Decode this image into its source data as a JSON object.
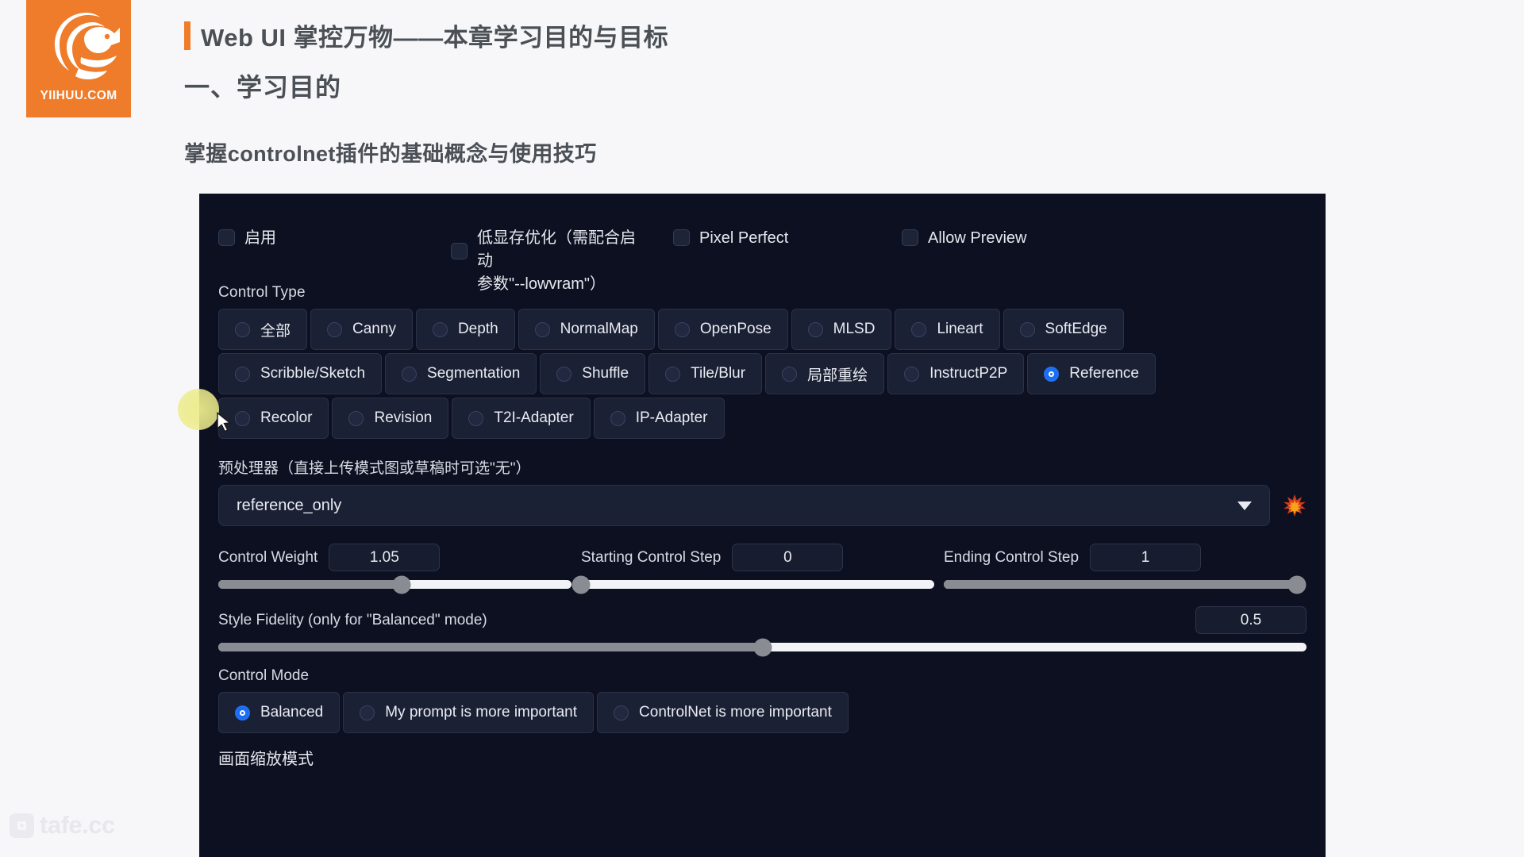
{
  "header": {
    "logo_text": "YIIHUU.COM",
    "logo_icon": "fox-logo-icon",
    "accent_color": "#ef7c2a",
    "title": "Web UI 掌控万物——本章学习目的与目标",
    "section": "一、学习目的",
    "body": "掌握controlnet插件的基础概念与使用技巧"
  },
  "watermark": {
    "text": "tafe.cc",
    "icon": "play-badge-icon"
  },
  "panel": {
    "background_color": "#0d1020",
    "checkboxes": [
      {
        "label": "启用",
        "checked": false
      },
      {
        "label": "低显存优化（需配合启动\n参数\"--lowvram\"）",
        "checked": false
      },
      {
        "label": "Pixel Perfect",
        "checked": false
      },
      {
        "label": "Allow Preview",
        "checked": false
      }
    ],
    "control_type": {
      "label": "Control Type",
      "selected": "Reference",
      "rows": [
        [
          {
            "label": "全部",
            "selected": false
          },
          {
            "label": "Canny",
            "selected": false
          },
          {
            "label": "Depth",
            "selected": false
          },
          {
            "label": "NormalMap",
            "selected": false
          },
          {
            "label": "OpenPose",
            "selected": false
          },
          {
            "label": "MLSD",
            "selected": false
          },
          {
            "label": "Lineart",
            "selected": false
          },
          {
            "label": "SoftEdge",
            "selected": false
          }
        ],
        [
          {
            "label": "Scribble/Sketch",
            "selected": false
          },
          {
            "label": "Segmentation",
            "selected": false
          },
          {
            "label": "Shuffle",
            "selected": false
          },
          {
            "label": "Tile/Blur",
            "selected": false
          },
          {
            "label": "局部重绘",
            "selected": false
          },
          {
            "label": "InstructP2P",
            "selected": false
          },
          {
            "label": "Reference",
            "selected": true
          }
        ],
        [
          {
            "label": "Recolor",
            "selected": false
          },
          {
            "label": "Revision",
            "selected": false
          },
          {
            "label": "T2I-Adapter",
            "selected": false
          },
          {
            "label": "IP-Adapter",
            "selected": false
          }
        ]
      ]
    },
    "preprocessor": {
      "label": "预处理器（直接上传模式图或草稿时可选\"无\"）",
      "value": "reference_only",
      "caret_icon": "chevron-down-icon",
      "burst_icon": "collision-burst-icon"
    },
    "sliders": [
      {
        "name": "Control Weight",
        "value": "1.05",
        "percent": 52
      },
      {
        "name": "Starting Control Step",
        "value": "0",
        "percent": 0
      },
      {
        "name": "Ending Control Step",
        "value": "1",
        "percent": 100
      }
    ],
    "style_fidelity": {
      "name": "Style Fidelity (only for \"Balanced\" mode)",
      "value": "0.5",
      "percent": 50
    },
    "control_mode": {
      "label": "Control Mode",
      "selected": "Balanced",
      "options": [
        {
          "label": "Balanced",
          "selected": true
        },
        {
          "label": "My prompt is more important",
          "selected": false
        },
        {
          "label": "ControlNet is more important",
          "selected": false
        }
      ]
    },
    "tail_label": "画面缩放模式",
    "accent_color": "#1a6ef5"
  }
}
